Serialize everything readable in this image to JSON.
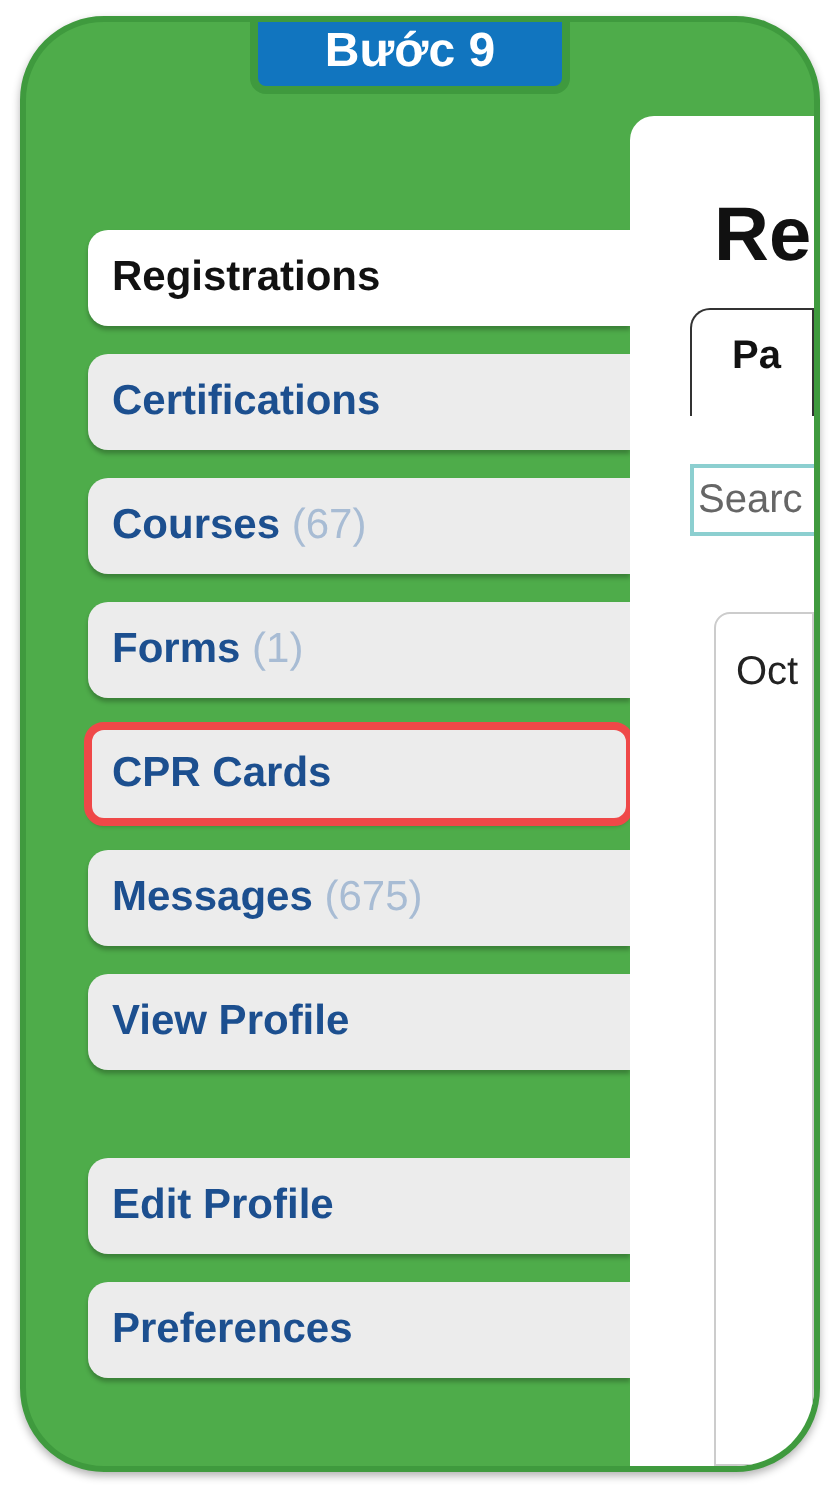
{
  "step_label": "Bước 9",
  "sidebar": {
    "groups": [
      {
        "items": [
          {
            "label": "Registrations",
            "selected": true,
            "highlighted": false
          },
          {
            "label": "Certifications",
            "selected": false,
            "highlighted": false
          },
          {
            "label": "Courses",
            "count": "(67)",
            "selected": false,
            "highlighted": false
          },
          {
            "label": "Forms",
            "count": "(1)",
            "selected": false,
            "highlighted": false
          },
          {
            "label": "CPR Cards",
            "selected": false,
            "highlighted": true
          },
          {
            "label": "Messages",
            "count": "(675)",
            "selected": false,
            "highlighted": false
          },
          {
            "label": "View Profile",
            "selected": false,
            "highlighted": false
          }
        ]
      },
      {
        "items": [
          {
            "label": "Edit Profile",
            "selected": false,
            "highlighted": false
          },
          {
            "label": "Preferences",
            "selected": false,
            "highlighted": false
          }
        ]
      }
    ]
  },
  "main": {
    "heading": "Re",
    "tabs": [
      {
        "label": "Pa",
        "selected": true
      }
    ],
    "search": {
      "placeholder": "Searc"
    },
    "card": {
      "text": "Oct"
    }
  }
}
